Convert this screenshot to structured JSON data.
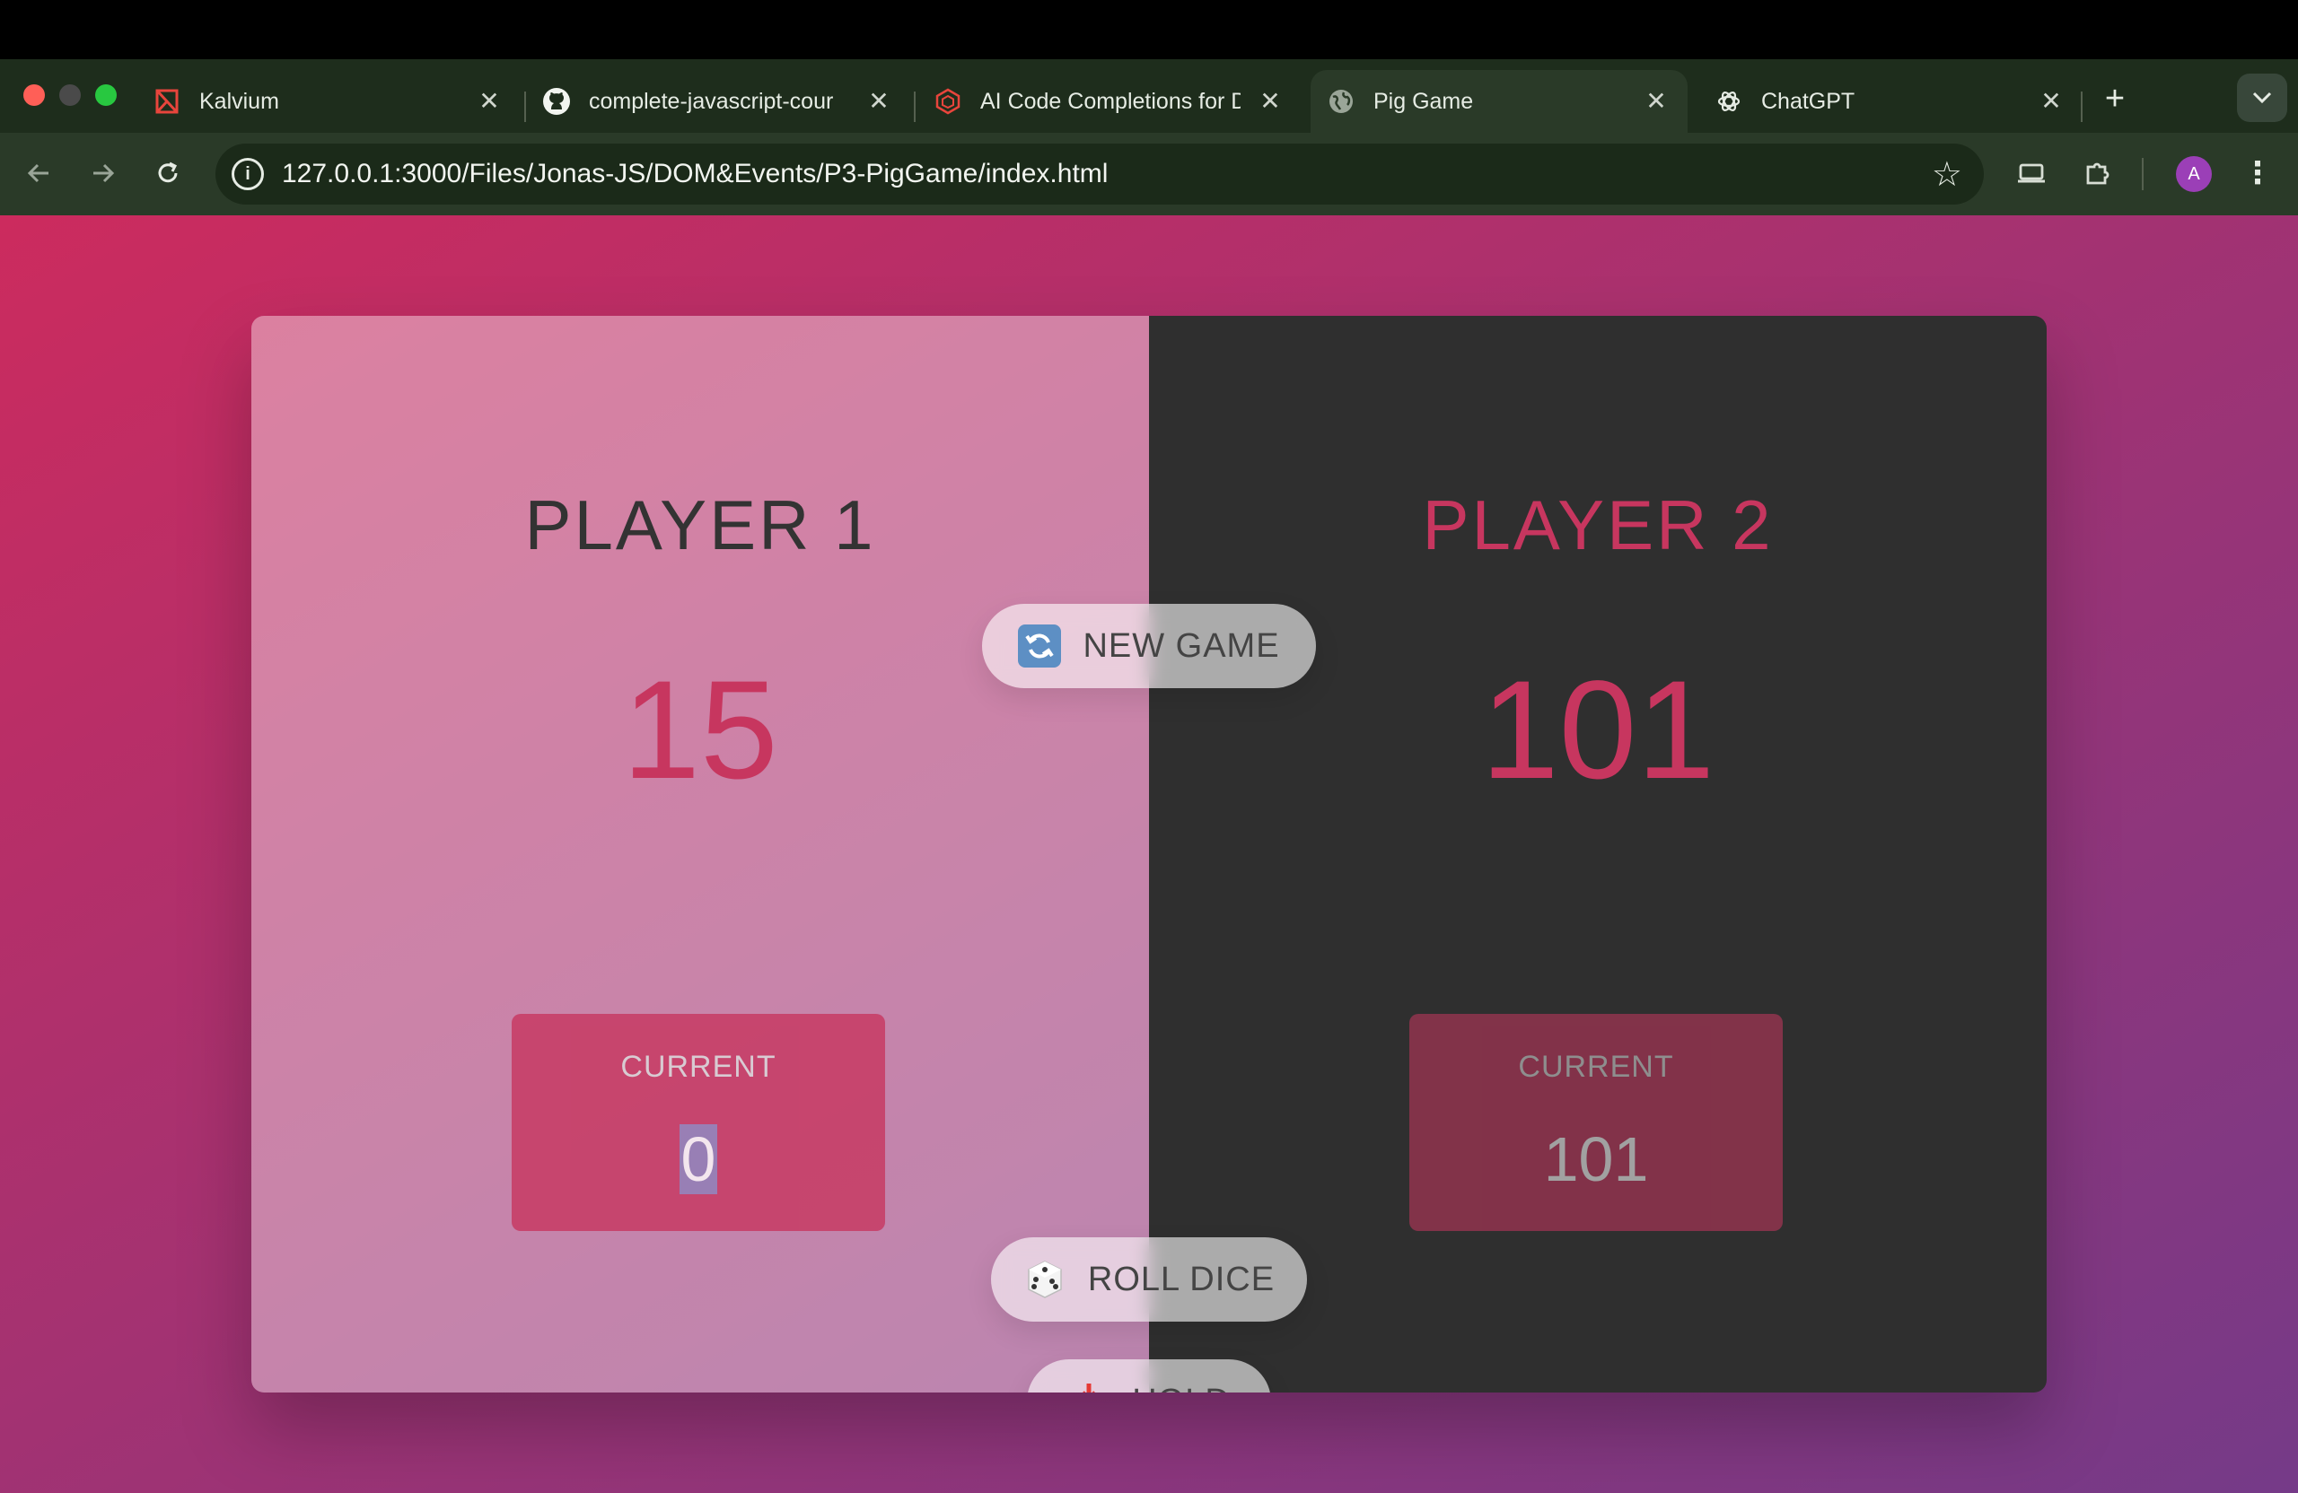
{
  "browser": {
    "tabs": [
      {
        "title": "Kalvium",
        "icon": "kalvium-icon",
        "active": false
      },
      {
        "title": "complete-javascript-cour",
        "icon": "github-icon",
        "active": false
      },
      {
        "title": "AI Code Completions for D",
        "icon": "codeium-icon",
        "active": false
      },
      {
        "title": "Pig Game",
        "icon": "globe-icon",
        "active": true
      },
      {
        "title": "ChatGPT",
        "icon": "chatgpt-icon",
        "active": false
      }
    ],
    "url": "127.0.0.1:3000/Files/Jonas-JS/DOM&Events/P3-PigGame/index.html",
    "profile_initial": "A",
    "colors": {
      "toolbar": "#2a3a28",
      "tabstrip": "#1e2d1c",
      "profile": "#9b3fb7"
    }
  },
  "game": {
    "players": [
      {
        "name": "PLAYER 1",
        "score": "15",
        "current_label": "CURRENT",
        "current_score": "0",
        "active": true
      },
      {
        "name": "PLAYER 2",
        "score": "101",
        "current_label": "CURRENT",
        "current_score": "101",
        "active": false
      }
    ],
    "buttons": {
      "new_game": "NEW GAME",
      "roll_dice": "ROLL DICE",
      "hold": "HOLD"
    },
    "icons": {
      "new_game": "refresh-icon",
      "roll_dice": "dice-icon",
      "hold": "inbox-tray-icon"
    },
    "colors": {
      "accent": "#c7365f",
      "dark_panel": "#2f2f2f",
      "gradient_start": "#cc2b5e",
      "gradient_end": "#753a88"
    }
  }
}
